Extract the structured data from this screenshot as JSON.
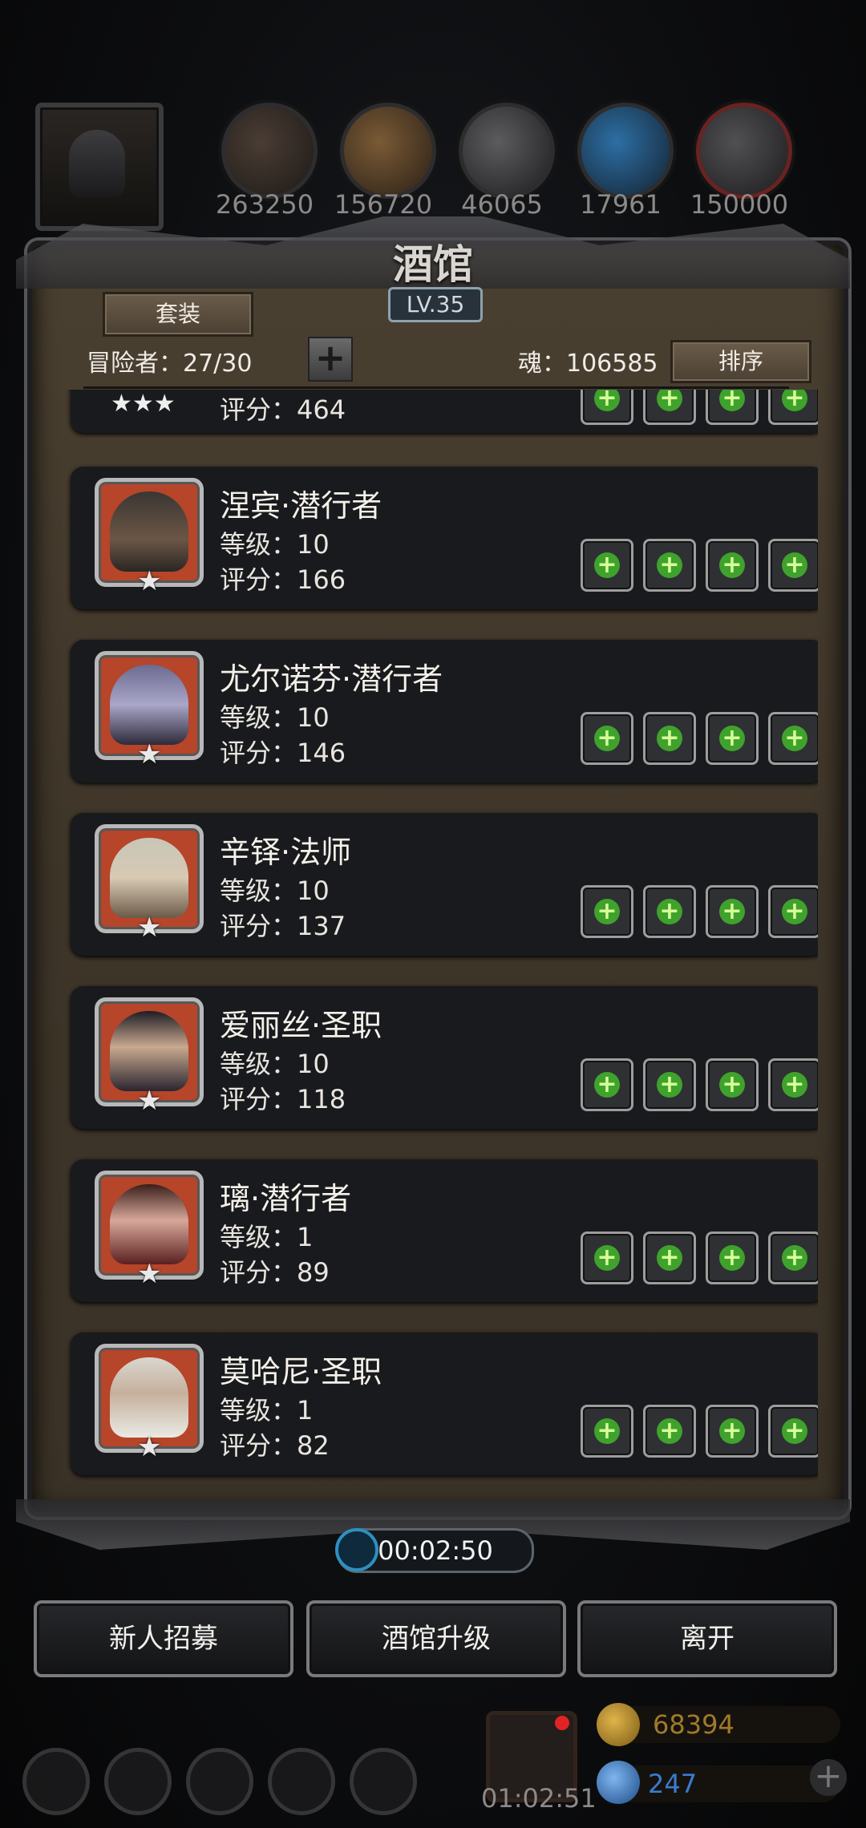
{
  "resources": {
    "values": [
      "263250",
      "156720",
      "46065",
      "17961",
      "150000"
    ],
    "icons": [
      "meat-icon",
      "wood-icon",
      "iron-icon",
      "crystal-icon",
      "stone-icon"
    ]
  },
  "header": {
    "title": "酒馆",
    "level": "LV.35",
    "outfit_button": "套装",
    "adventurers": "冒险者：27/30",
    "soul": "魂：106585",
    "sort_button": "排序"
  },
  "partial_card": {
    "stars": "★★★",
    "score": "评分：464"
  },
  "heroes": [
    {
      "name": "涅宾·潜行者",
      "level": "等级：10",
      "score": "评分：166",
      "star": "★"
    },
    {
      "name": "尤尔诺芬·潜行者",
      "level": "等级：10",
      "score": "评分：146",
      "star": "★"
    },
    {
      "name": "辛铎·法师",
      "level": "等级：10",
      "score": "评分：137",
      "star": "★"
    },
    {
      "name": "爱丽丝·圣职",
      "level": "等级：10",
      "score": "评分：118",
      "star": "★"
    },
    {
      "name": "璃·潜行者",
      "level": "等级：1",
      "score": "评分：89",
      "star": "★"
    },
    {
      "name": "莫哈尼·圣职",
      "level": "等级：1",
      "score": "评分：82",
      "star": "★"
    }
  ],
  "slot_plus": "+",
  "timer": "00:02:50",
  "actions": {
    "recruit": "新人招募",
    "upgrade": "酒馆升级",
    "leave": "离开"
  },
  "bottom": {
    "gift_timer": "01:02:51",
    "gold": "68394",
    "gems": "247",
    "add_symbol": "+"
  },
  "colors": {
    "panel": "#3e3529",
    "portrait_bg": "#b6452a",
    "slot_plus": "#3fa22c",
    "gold": "#a07a2a",
    "gem": "#3a7bd0"
  }
}
